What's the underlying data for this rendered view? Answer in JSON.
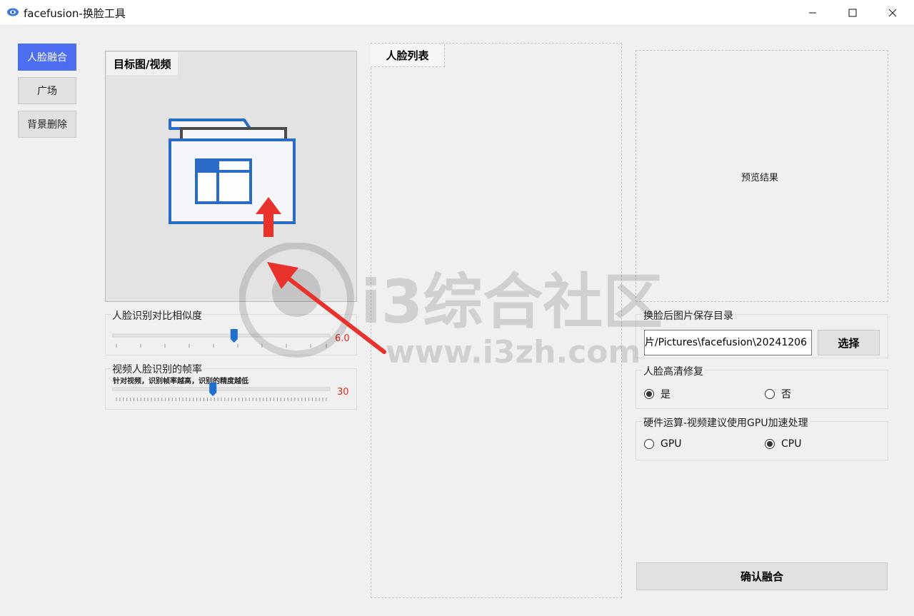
{
  "window": {
    "title": "facefusion-换脸工具"
  },
  "nav": [
    {
      "label": "人脸融合",
      "active": true
    },
    {
      "label": "广场",
      "active": false
    },
    {
      "label": "背景删除",
      "active": false
    }
  ],
  "target": {
    "label": "目标图/视频",
    "icon": "folder-upload-icon"
  },
  "similarity": {
    "title": "人脸识别对比相似度",
    "value": "6.0",
    "level": 0.56
  },
  "framerate": {
    "title": "视频人脸识别的帧率",
    "hint": "针对视频，识别帧率越高，识别的精度越低",
    "value": "30",
    "level": 0.46
  },
  "face_list": {
    "label": "人脸列表"
  },
  "preview": {
    "text": "预览结果"
  },
  "save_dir": {
    "title": "换脸后图片保存目录",
    "value": "片/Pictures\\facefusion\\20241206",
    "button": "选择"
  },
  "hd_repair": {
    "title": "人脸高清修复",
    "options": [
      {
        "label": "是",
        "selected": true
      },
      {
        "label": "否",
        "selected": false
      }
    ]
  },
  "hardware": {
    "title": "硬件运算-视频建议使用GPU加速处理",
    "options": [
      {
        "label": "GPU",
        "selected": false
      },
      {
        "label": "CPU",
        "selected": true
      }
    ]
  },
  "confirm_button": "确认融合",
  "watermark": {
    "text": "i3综合社区",
    "url": "www.i3zh.com"
  },
  "colors": {
    "accent": "#4e6ef2",
    "value_red": "#e0281e",
    "slider_thumb": "#1f6fd1",
    "folder_blue": "#2a6bc7",
    "arrow_red": "#e8322b"
  }
}
